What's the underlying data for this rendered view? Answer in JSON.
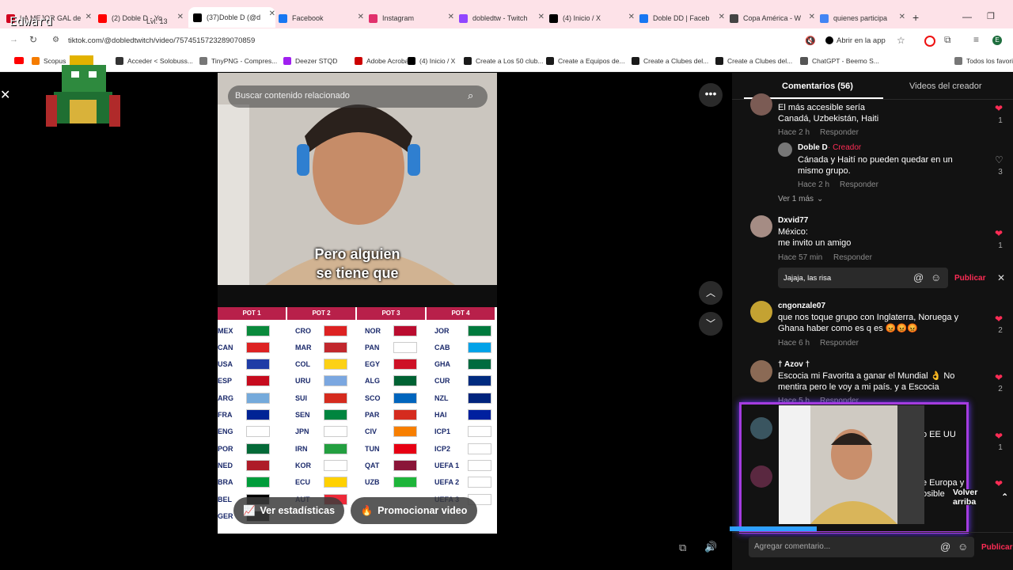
{
  "tabs": [
    {
      "label": "LA MEJOR GAL de",
      "color": "#d1001f"
    },
    {
      "label": "(2) Doble D - Yo",
      "color": "#ff0000"
    },
    {
      "label": "(37)Doble D (@d",
      "color": "#000000"
    },
    {
      "label": "Facebook",
      "color": "#1877f2"
    },
    {
      "label": "Instagram",
      "color": "#e1306c"
    },
    {
      "label": "dobledtw - Twitch",
      "color": "#9146ff"
    },
    {
      "label": "(4) Inicio / X",
      "color": "#000000"
    },
    {
      "label": "Doble DD | Faceb",
      "color": "#1877f2"
    },
    {
      "label": "Copa América - W",
      "color": "#444444"
    },
    {
      "label": "quienes participa",
      "color": "#4285f4"
    }
  ],
  "overlay": {
    "name": "Edward",
    "level": "Lvl: 13"
  },
  "address": {
    "url": "tiktok.com/@dobledtwitch/video/7574515723289070859",
    "open_app": "Abrir en la app"
  },
  "bookmarks": [
    "Scopus",
    "Acceder < Solobuss...",
    "TinyPNG - Compres...",
    "Deezer STQD",
    "Adobe Acrobat",
    "(4) Inicio / X",
    "Create a Los 50 club...",
    "Create a Equipos de...",
    "Create a Clubes del...",
    "Create a Clubes del...",
    "ChatGPT - Beemo S...",
    "Todos los favoritos"
  ],
  "video": {
    "search_placeholder": "Buscar contenido relacionado",
    "subtitle_line1": "Pero alguien",
    "subtitle_line2": "se tiene que",
    "pots": [
      {
        "title": "POT 1",
        "teams": [
          "MEX",
          "CAN",
          "USA",
          "ESP",
          "ARG",
          "FRA",
          "ENG",
          "POR",
          "NED",
          "BRA",
          "BEL",
          "GER"
        ]
      },
      {
        "title": "POT 2",
        "teams": [
          "CRO",
          "MAR",
          "COL",
          "URU",
          "SUI",
          "SEN",
          "JPN",
          "IRN",
          "KOR",
          "ECU",
          "AUT",
          ""
        ]
      },
      {
        "title": "POT 3",
        "teams": [
          "NOR",
          "PAN",
          "EGY",
          "ALG",
          "SCO",
          "PAR",
          "CIV",
          "TUN",
          "QAT",
          "UZB",
          "",
          ""
        ]
      },
      {
        "title": "POT 4",
        "teams": [
          "JOR",
          "CAB",
          "GHA",
          "CUR",
          "NZL",
          "HAI",
          "ICP1",
          "ICP2",
          "UEFA 1",
          "UEFA 2",
          "UEFA 3",
          ""
        ]
      }
    ],
    "stats_button": "Ver estadísticas",
    "promote_button": "Promocionar video"
  },
  "comments_panel": {
    "tab_comments": "Comentarios (56)",
    "tab_creator": "Videos del creador",
    "items": [
      {
        "text1": "El más accesible sería",
        "text2": "Canadá, Uzbekistán, Haiti",
        "time": "Hace 2 h",
        "reply": "Responder",
        "likes": "1"
      },
      {
        "author": "Doble D",
        "creator": "· Creador",
        "text1": "Cánada y Haití no pueden quedar en un",
        "text2": "mismo grupo.",
        "time": "Hace 2 h",
        "reply": "Responder",
        "likes": "3"
      },
      {
        "more": "Ver 1 más"
      },
      {
        "author": "Dxvid77",
        "text1": "México:",
        "text2": "me invito un amigo",
        "time": "Hace 57 min",
        "reply": "Responder",
        "likes": "1"
      },
      {
        "author": "cngonzale07",
        "text1": "que nos toque grupo con Inglaterra, Noruega y",
        "text2": "Ghana haber como es q es 😡😡😡",
        "time": "Hace 6 h",
        "reply": "Responder",
        "likes": "2"
      },
      {
        "author": "† Azov †",
        "text1": "Escocia mi Favorita a ganar el Mundial 👌 No",
        "text2": "mentira pero le voy a mi país. y a Escocia",
        "time": "Hace 5 h",
        "reply": "Responder",
        "likes": "2"
      },
      {
        "text1": "o EE UU",
        "likes": "1"
      },
      {
        "text1": "e Europa y",
        "text2": "osible"
      }
    ],
    "reply_input": "Jajaja, las risa",
    "publish": "Publicar",
    "back_top": "Volver arriba",
    "add_comment_placeholder": "Agregar comentario...",
    "publish_bottom": "Publicar"
  }
}
